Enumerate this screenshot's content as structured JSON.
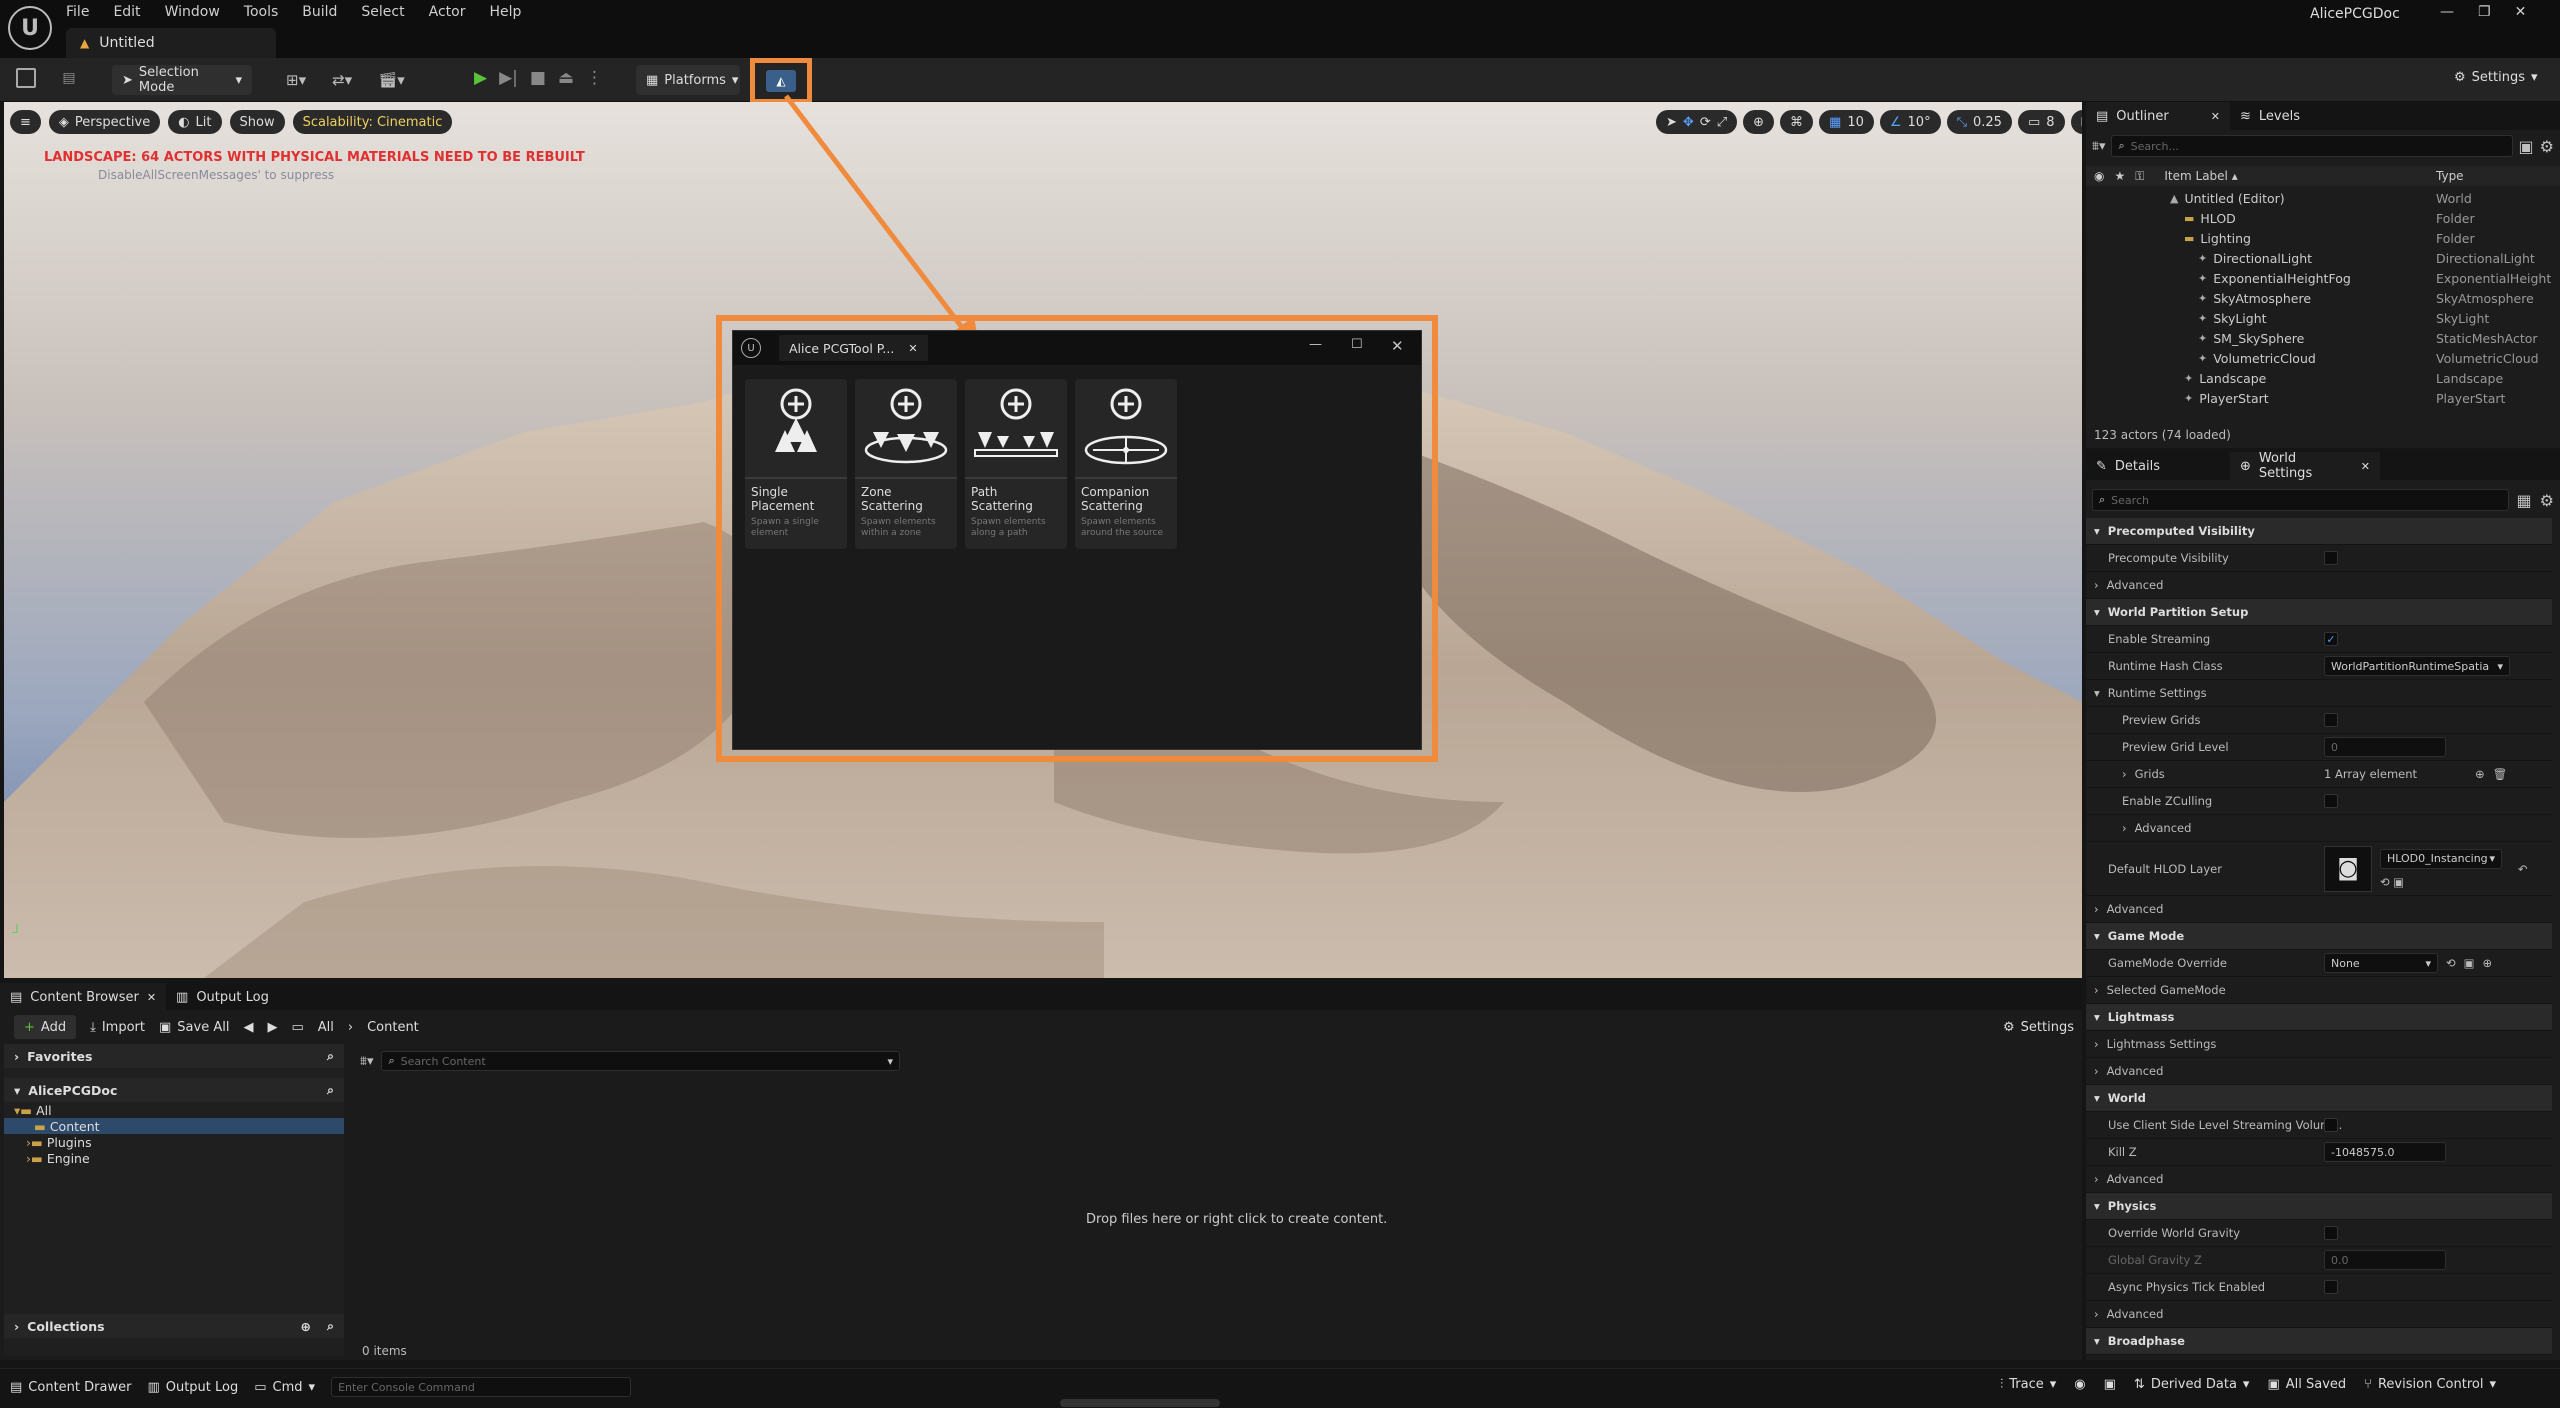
{
  "app": {
    "project_name": "AlicePCGDoc",
    "doc_tab": "Untitled"
  },
  "menu": [
    "File",
    "Edit",
    "Window",
    "Tools",
    "Build",
    "Select",
    "Actor",
    "Help"
  ],
  "toolbar": {
    "selection_mode": "Selection Mode",
    "platforms": "Platforms",
    "settings": "Settings"
  },
  "viewport": {
    "perspective": "Perspective",
    "lit": "Lit",
    "show": "Show",
    "scalability": "Scalability: Cinematic",
    "warning": "LANDSCAPE: 64 ACTORS WITH PHYSICAL MATERIALS NEED TO BE REBUILT",
    "suppress": "DisableAllScreenMessages' to suppress",
    "grid": "10",
    "angle": "10°",
    "scale": "0.25",
    "camera_speed": "8"
  },
  "plugin": {
    "title": "Alice PCGTool P...",
    "cards": [
      {
        "title": "Single Placement",
        "sub": "Spawn a single element"
      },
      {
        "title": "Zone Scattering",
        "sub": "Spawn elements within a zone"
      },
      {
        "title": "Path Scattering",
        "sub": "Spawn elements along a path"
      },
      {
        "title": "Companion Scattering",
        "sub": "Spawn elements around the source"
      }
    ]
  },
  "outliner": {
    "tab": "Outliner",
    "tab2": "Levels",
    "search_placeholder": "Search...",
    "col_label": "Item Label ▴",
    "col_type": "Type",
    "rows": [
      {
        "label": "Untitled (Editor)",
        "type": "World",
        "indent": 0
      },
      {
        "label": "HLOD",
        "type": "Folder",
        "indent": 1
      },
      {
        "label": "Lighting",
        "type": "Folder",
        "indent": 1
      },
      {
        "label": "DirectionalLight",
        "type": "DirectionalLight",
        "indent": 2
      },
      {
        "label": "ExponentialHeightFog",
        "type": "ExponentialHeight",
        "indent": 2
      },
      {
        "label": "SkyAtmosphere",
        "type": "SkyAtmosphere",
        "indent": 2
      },
      {
        "label": "SkyLight",
        "type": "SkyLight",
        "indent": 2
      },
      {
        "label": "SM_SkySphere",
        "type": "StaticMeshActor",
        "indent": 2
      },
      {
        "label": "VolumetricCloud",
        "type": "VolumetricCloud",
        "indent": 2
      },
      {
        "label": "Landscape",
        "type": "Landscape",
        "indent": 1
      },
      {
        "label": "PlayerStart",
        "type": "PlayerStart",
        "indent": 1
      }
    ],
    "count": "123 actors (74 loaded)"
  },
  "details": {
    "tab": "Details",
    "tab2": "World Settings",
    "search_placeholder": "Search",
    "rows": [
      {
        "kind": "sec",
        "label": "Precomputed Visibility"
      },
      {
        "kind": "chk",
        "label": "Precompute Visibility",
        "checked": false
      },
      {
        "kind": "adv",
        "label": "Advanced"
      },
      {
        "kind": "sec",
        "label": "World Partition Setup"
      },
      {
        "kind": "chk",
        "label": "Enable Streaming",
        "checked": true
      },
      {
        "kind": "sel",
        "label": "Runtime Hash Class",
        "value": "WorldPartitionRuntimeSpatialH"
      },
      {
        "kind": "sub",
        "label": "Runtime Settings"
      },
      {
        "kind": "chk2",
        "label": "Preview Grids",
        "checked": false
      },
      {
        "kind": "fld2",
        "label": "Preview Grid Level",
        "value": "0"
      },
      {
        "kind": "arr",
        "label": "Grids",
        "value": "1 Array element"
      },
      {
        "kind": "chk2",
        "label": "Enable ZCulling",
        "checked": false
      },
      {
        "kind": "adv2",
        "label": "Advanced"
      },
      {
        "kind": "hlod",
        "label": "Default HLOD Layer",
        "value": "HLOD0_Instancing"
      },
      {
        "kind": "adv",
        "label": "Advanced"
      },
      {
        "kind": "sec",
        "label": "Game Mode"
      },
      {
        "kind": "sel",
        "label": "GameMode Override",
        "value": "None"
      },
      {
        "kind": "adv",
        "label": "Selected GameMode"
      },
      {
        "kind": "sec",
        "label": "Lightmass"
      },
      {
        "kind": "adv",
        "label": "Lightmass Settings"
      },
      {
        "kind": "adv",
        "label": "Advanced"
      },
      {
        "kind": "sec",
        "label": "World"
      },
      {
        "kind": "chk",
        "label": "Use Client Side Level Streaming Volum...",
        "checked": false
      },
      {
        "kind": "fld",
        "label": "Kill Z",
        "value": "-1048575.0"
      },
      {
        "kind": "adv",
        "label": "Advanced"
      },
      {
        "kind": "sec",
        "label": "Physics"
      },
      {
        "kind": "chk",
        "label": "Override World Gravity",
        "checked": false
      },
      {
        "kind": "fldd",
        "label": "Global Gravity Z",
        "value": "0.0"
      },
      {
        "kind": "chk",
        "label": "Async Physics Tick Enabled",
        "checked": false
      },
      {
        "kind": "adv",
        "label": "Advanced"
      },
      {
        "kind": "sec",
        "label": "Broadphase"
      }
    ]
  },
  "content_browser": {
    "tab": "Content Browser",
    "tab2": "Output Log",
    "add": "Add",
    "import": "Import",
    "save_all": "Save All",
    "crumb1": "All",
    "crumb2": "Content",
    "settings": "Settings",
    "favorites": "Favorites",
    "project": "AlicePCGDoc",
    "tree": [
      "All",
      "Content",
      "Plugins",
      "Engine"
    ],
    "collections": "Collections",
    "search_placeholder": "Search Content",
    "empty": "Drop files here or right click to create content.",
    "items": "0 items"
  },
  "statusbar": {
    "content_drawer": "Content Drawer",
    "output_log": "Output Log",
    "cmd": "Cmd",
    "console_placeholder": "Enter Console Command",
    "trace": "Trace",
    "derived": "Derived Data",
    "saved": "All Saved",
    "revision": "Revision Control"
  }
}
